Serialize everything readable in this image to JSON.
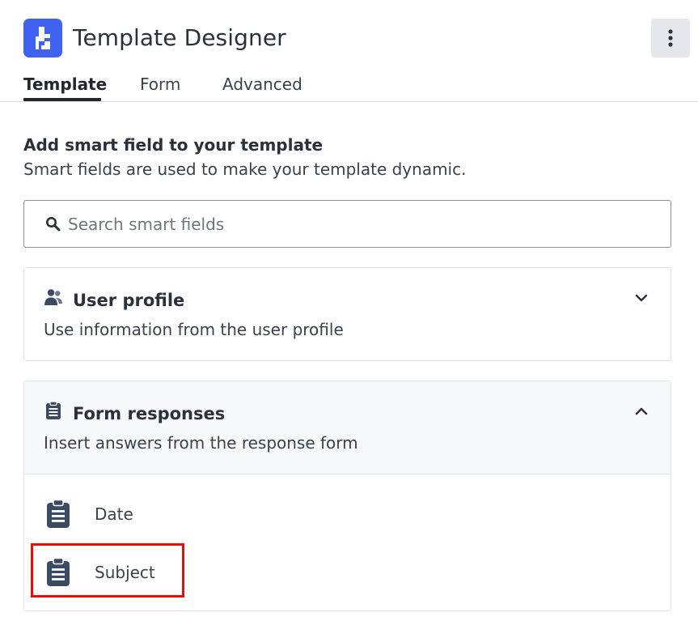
{
  "app": {
    "title": "Template Designer",
    "brand_color": "#3f63f0",
    "logo_icon": "app-logo-icon",
    "menu_icon": "more-vertical-icon"
  },
  "tabs": [
    {
      "label": "Template",
      "active": true
    },
    {
      "label": "Form",
      "active": false
    },
    {
      "label": "Advanced",
      "active": false
    }
  ],
  "section": {
    "title": "Add smart field to your template",
    "subtitle": "Smart fields are used to make your template dynamic."
  },
  "search": {
    "placeholder": "Search smart fields",
    "value": "",
    "icon": "search-icon"
  },
  "groups": [
    {
      "title": "User profile",
      "description": "Use information from the user profile",
      "icon": "users-icon",
      "expanded": false,
      "chevron": "chevron-down-icon"
    },
    {
      "title": "Form responses",
      "description": "Insert answers from the response form",
      "icon": "clipboard-icon",
      "expanded": true,
      "chevron": "chevron-up-icon",
      "items": [
        {
          "label": "Date",
          "icon": "clipboard-icon"
        },
        {
          "label": "Subject",
          "icon": "clipboard-icon",
          "highlighted": true
        }
      ]
    }
  ],
  "colors": {
    "text": "#2a313b",
    "icon": "#3b4a61",
    "highlight_border": "#e00f10"
  }
}
